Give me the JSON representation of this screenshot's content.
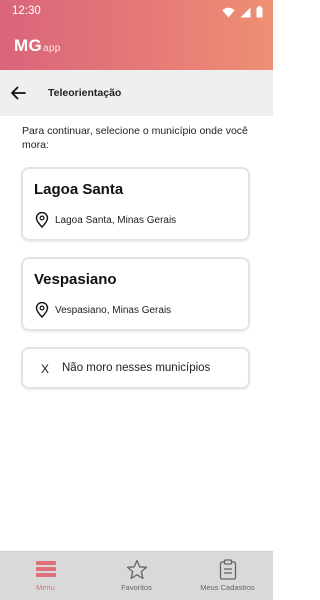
{
  "status_bar": {
    "time": "12:30"
  },
  "header": {
    "logo_main": "MG",
    "logo_sub": "app"
  },
  "subheader": {
    "title": "Teleorientação"
  },
  "instruction": "Para continuar, selecione o município onde você mora:",
  "municipalities": [
    {
      "name": "Lagoa Santa",
      "location": "Lagoa Santa, Minas Gerais"
    },
    {
      "name": "Vespasiano",
      "location": "Vespasiano, Minas Gerais"
    }
  ],
  "none_option": {
    "icon_text": "X",
    "label": "Não moro nesses municípios"
  },
  "bottom_nav": [
    {
      "label": "Menu",
      "icon": "menu-icon",
      "active": true
    },
    {
      "label": "Favoritos",
      "icon": "star-icon",
      "active": false
    },
    {
      "label": "Meus Cadastros",
      "icon": "clipboard-icon",
      "active": false
    }
  ],
  "colors": {
    "header_gradient_start": "#d9657a",
    "header_gradient_end": "#ee8f73",
    "active_nav": "#e0707a",
    "subheader_bg": "#efefef",
    "nav_bg": "#d9d9d9"
  }
}
